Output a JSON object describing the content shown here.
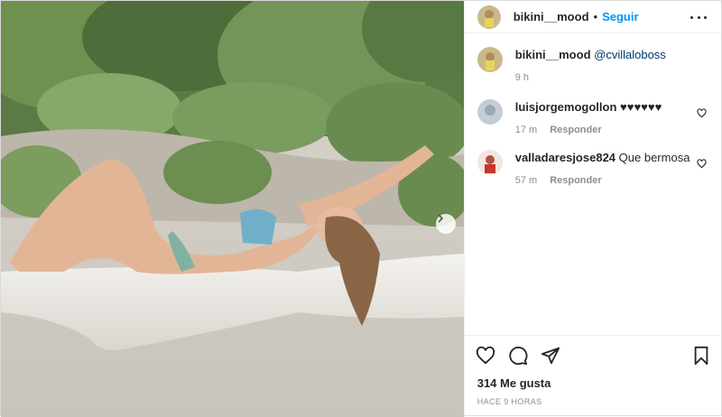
{
  "post": {
    "username": "bikini__mood",
    "separator": "•",
    "follow_label": "Seguir",
    "caption_mention": "@cvillaloboss",
    "caption_time": "9 h"
  },
  "comments": [
    {
      "username": "luisjorgemogollon",
      "text": "♥♥♥♥♥♥",
      "time": "17 m",
      "reply_label": "Responder"
    },
    {
      "username": "valladaresjose824",
      "text": "Que bermosa",
      "time": "57 m",
      "reply_label": "Responder"
    }
  ],
  "footer": {
    "likes": "314 Me gusta",
    "timestamp": "HACE 9 HORAS"
  },
  "icons": {
    "like": "heart-icon",
    "comment": "comment-icon",
    "share": "share-icon",
    "save": "bookmark-icon",
    "more": "more-options-icon",
    "next": "chevron-right-icon"
  },
  "colors": {
    "accent": "#0095f6",
    "text": "#262626",
    "muted": "#8e8e8e"
  }
}
